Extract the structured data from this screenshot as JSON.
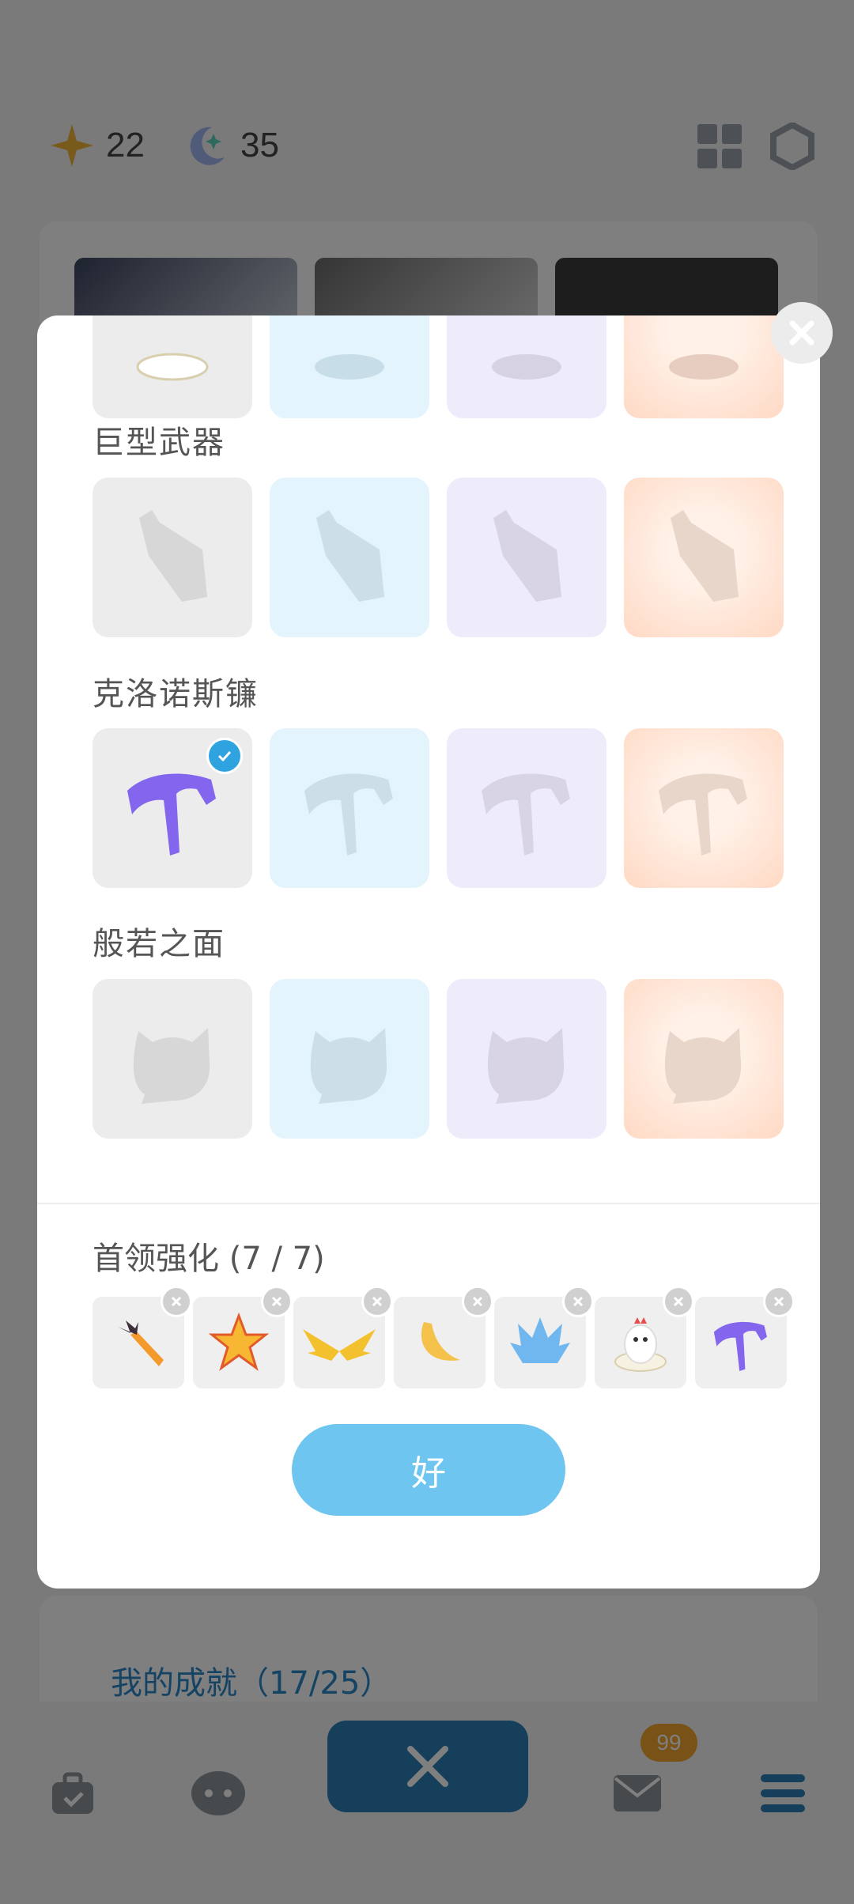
{
  "header": {
    "star_count": "22",
    "moon_count": "35",
    "icons": [
      "star-currency-icon",
      "moon-currency-icon",
      "grid-icon",
      "hexagon-settings-icon"
    ]
  },
  "achievements": {
    "link_text": "我的成就（17/25）"
  },
  "bottom_nav": {
    "items": [
      "bag-icon",
      "character-icon",
      "battle-swords-icon",
      "mail-icon",
      "menu-icon"
    ],
    "mail_badge": "99"
  },
  "modal": {
    "sections": [
      {
        "title": "巨型武器"
      },
      {
        "title": "克洛诺斯镰"
      },
      {
        "title": "般若之面"
      }
    ],
    "boss_title": "首领强化 (7 / 7)",
    "boss_items": [
      "bat-sword-icon",
      "star-icon",
      "golden-wings-icon",
      "banana-icon",
      "blue-flower-icon",
      "chicken-icon",
      "purple-scythe-icon"
    ],
    "ok_label": "好"
  },
  "colors": {
    "accent": "#6ec5ef",
    "check": "#2ea3e0",
    "link": "#2b86c8",
    "badge": "#f0a52d"
  }
}
